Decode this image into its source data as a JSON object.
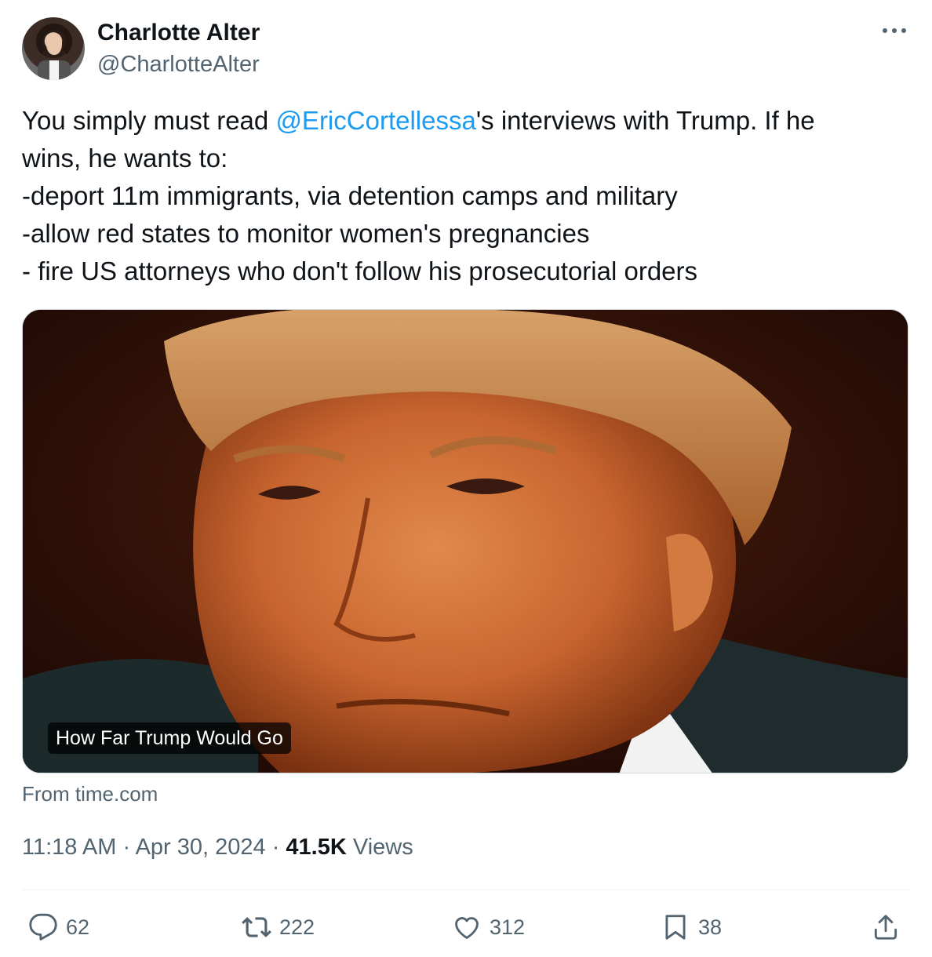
{
  "author": {
    "name": "Charlotte Alter",
    "handle": "@CharlotteAlter"
  },
  "more_icon": "more-horizontal-icon",
  "tweet": {
    "line1_pre": "You simply must read ",
    "mention": "@EricCortellessa",
    "line1_post": "'s interviews with Trump. If he",
    "line2": "wins, he wants to:",
    "line3": "-deport 11m immigrants, via detention camps and military",
    "line4": "-allow red states to monitor women's pregnancies",
    "line5": "- fire US attorneys who don't follow his prosecutorial orders"
  },
  "card": {
    "title": "How Far Trump Would Go",
    "source": "From time.com"
  },
  "meta": {
    "time": "11:18 AM",
    "sep1": " · ",
    "date": "Apr 30, 2024",
    "sep2": " · ",
    "views_count": "41.5K",
    "views_label": " Views"
  },
  "actions": {
    "replies": "62",
    "reposts": "222",
    "likes": "312",
    "bookmarks": "38"
  },
  "colors": {
    "link": "#1d9bf0",
    "secondary": "#536471",
    "text": "#0f1419"
  }
}
